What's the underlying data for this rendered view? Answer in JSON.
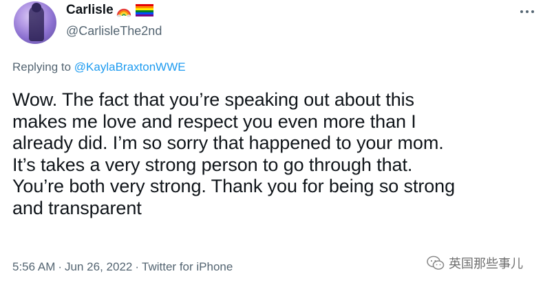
{
  "author": {
    "display_name": "Carlisle",
    "name_emojis": [
      "rainbow-icon",
      "pride-flag-icon"
    ],
    "handle": "@CarlisleThe2nd"
  },
  "reply": {
    "prefix": "Replying to ",
    "mention": "@KaylaBraxtonWWE"
  },
  "tweet": {
    "text": "Wow. The fact that you’re speaking out about this\nmakes me love and respect you even more than I\nalready did. I’m so sorry that happened to your mom.\nIt’s takes a very strong person to go through that.\nYou’re both very strong. Thank you for being so strong\nand transparent",
    "time": "5:56 AM",
    "separator": "·",
    "date": "Jun 26, 2022",
    "source": "Twitter for iPhone"
  },
  "watermark": {
    "text": "英国那些事儿"
  },
  "colors": {
    "text": "#0f1419",
    "secondary": "#536471",
    "link": "#1d9bf0"
  }
}
